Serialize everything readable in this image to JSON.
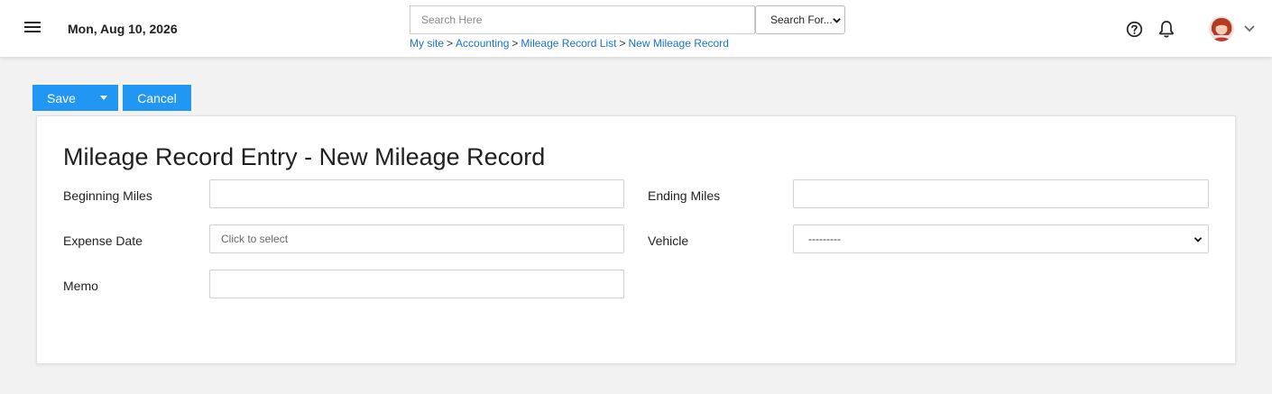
{
  "header": {
    "date": "Mon, Aug 10, 2026",
    "search": {
      "placeholder": "Search Here",
      "value": ""
    },
    "search_for": {
      "selected": "Search For..."
    },
    "breadcrumb": [
      {
        "label": "My site"
      },
      {
        "label": "Accounting"
      },
      {
        "label": "Mileage Record List"
      },
      {
        "label": "New Mileage Record"
      }
    ],
    "separator": ">",
    "icons": [
      "menu-icon",
      "help-icon",
      "bell-icon",
      "chevron-down-icon"
    ]
  },
  "toolbar": {
    "save_label": "Save",
    "cancel_label": "Cancel"
  },
  "form": {
    "title": "Mileage Record Entry - New Mileage Record",
    "beginning_miles": {
      "label": "Beginning Miles",
      "value": ""
    },
    "ending_miles": {
      "label": "Ending Miles",
      "value": ""
    },
    "expense_date": {
      "label": "Expense Date",
      "placeholder": "Click to select"
    },
    "vehicle": {
      "label": "Vehicle",
      "selected": "---------"
    },
    "memo": {
      "label": "Memo",
      "value": ""
    }
  },
  "colors": {
    "accent": "#2196f3",
    "link": "#1a73c8",
    "background": "#f2f2f2"
  }
}
